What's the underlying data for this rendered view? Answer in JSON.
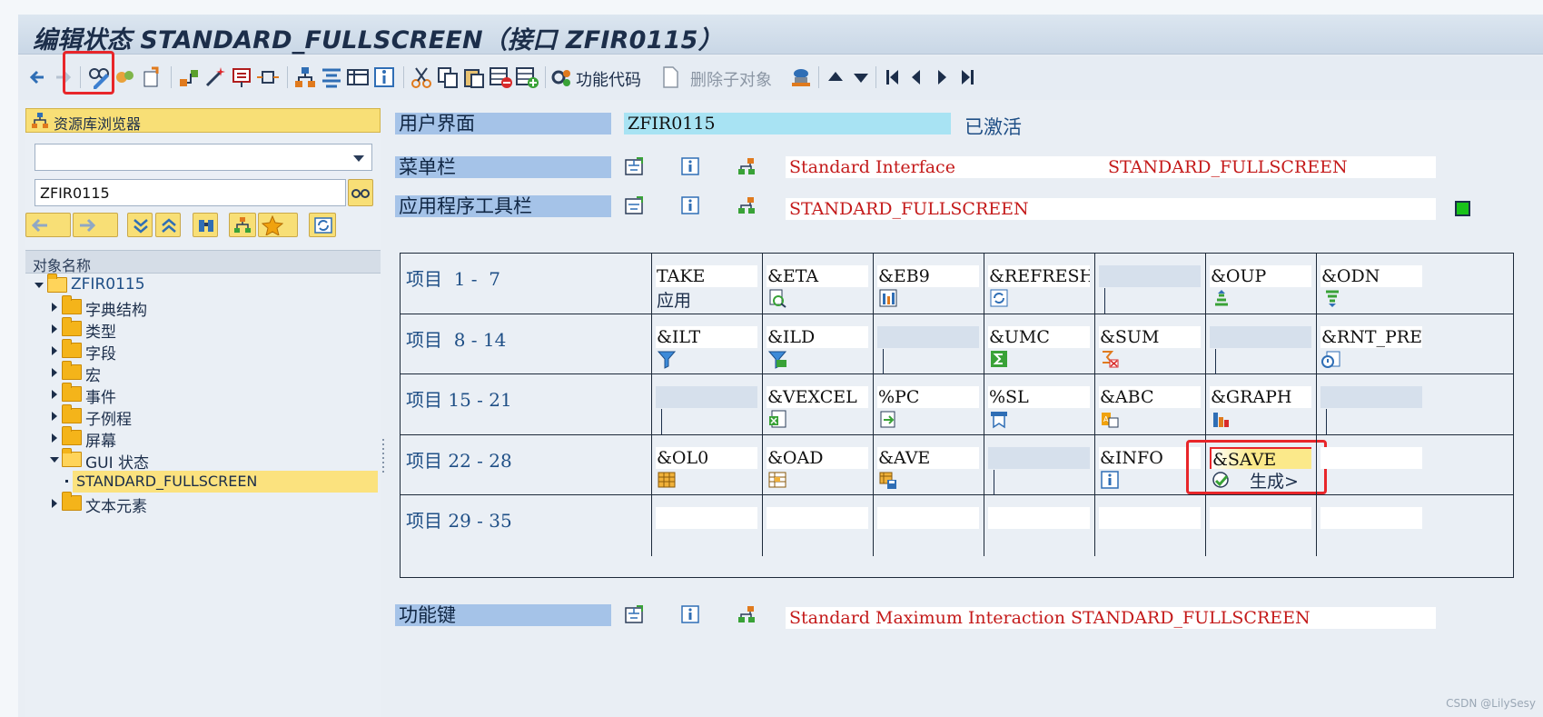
{
  "window": {
    "title": "编辑状态 STANDARD_FULLSCREEN（接口 ZFIR0115）"
  },
  "toolbar": {
    "function_code_label": "功能代码",
    "delete_subobject_label": "删除子对象"
  },
  "left_panel": {
    "repository_browser_label": "资源库浏览器",
    "object_type_value": "",
    "object_name_value": "ZFIR0115",
    "tree_header": "对象名称",
    "tree": {
      "root": "ZFIR0115",
      "items": [
        "字典结构",
        "类型",
        "字段",
        "宏",
        "事件",
        "子例程",
        "屏幕"
      ],
      "gui_status_prefix": "GUI",
      "gui_status_suffix": "状态",
      "selected_status": "STANDARD_FULLSCREEN",
      "text_elements": "文本元素"
    }
  },
  "right_panel": {
    "user_interface": {
      "label": "用户界面",
      "value": "ZFIR0115",
      "status": "已激活"
    },
    "menu_bar": {
      "label": "菜单栏",
      "value_left": "Standard Interface",
      "value_right": "STANDARD_FULLSCREEN"
    },
    "app_toolbar": {
      "label": "应用程序工具栏",
      "value": "STANDARD_FULLSCREEN",
      "status_color": "#19c21a"
    },
    "function_keys": {
      "label": "功能键",
      "value": "Standard Maximum Interaction STANDARD_FULLSCREEN"
    }
  },
  "grid": {
    "rows": [
      {
        "title": "项目  1 -  7",
        "cells": [
          {
            "code": "TAKE",
            "sub": "应用",
            "icon": "none"
          },
          {
            "code": "&ETA",
            "icon": "detail-icon"
          },
          {
            "code": "&EB9",
            "icon": "chart-icon"
          },
          {
            "code": "&REFRESH",
            "icon": "refresh-icon"
          },
          {
            "code": "",
            "icon": "none",
            "bar": true
          },
          {
            "code": "&OUP",
            "icon": "sort-up-icon"
          },
          {
            "code": "&ODN",
            "icon": "sort-down-icon"
          }
        ]
      },
      {
        "title": "项目  8 - 14",
        "cells": [
          {
            "code": "&ILT",
            "icon": "filter-icon"
          },
          {
            "code": "&ILD",
            "icon": "filter-delete-icon"
          },
          {
            "code": "",
            "icon": "none",
            "bar": true
          },
          {
            "code": "&UMC",
            "icon": "sum-icon"
          },
          {
            "code": "&SUM",
            "icon": "subtotal-icon"
          },
          {
            "code": "",
            "icon": "none",
            "bar": true
          },
          {
            "code": "&RNT_PREV",
            "icon": "print-preview-icon"
          }
        ]
      },
      {
        "title": "项目 15 - 21",
        "cells": [
          {
            "code": "",
            "icon": "none",
            "bar": true
          },
          {
            "code": "&VEXCEL",
            "icon": "excel-icon"
          },
          {
            "code": "%PC",
            "icon": "export-icon"
          },
          {
            "code": "%SL",
            "icon": "mail-icon"
          },
          {
            "code": "&ABC",
            "icon": "abc-analysis-icon"
          },
          {
            "code": "&GRAPH",
            "icon": "graph-icon"
          },
          {
            "code": "",
            "icon": "none",
            "bar": true
          }
        ]
      },
      {
        "title": "项目 22 - 28",
        "cells": [
          {
            "code": "&OL0",
            "icon": "layout-icon"
          },
          {
            "code": "&OAD",
            "icon": "layout-select-icon"
          },
          {
            "code": "&AVE",
            "icon": "layout-save-icon"
          },
          {
            "code": "",
            "icon": "none",
            "bar": true
          },
          {
            "code": "&INFO",
            "icon": "info-icon"
          },
          {
            "code": "&SAVE",
            "sub": "生成>",
            "icon": "generate-icon",
            "highlight": true
          },
          {
            "code": "",
            "icon": "none"
          }
        ]
      },
      {
        "title": "项目 29 - 35",
        "cells": [
          {
            "code": "",
            "icon": "none"
          },
          {
            "code": "",
            "icon": "none"
          },
          {
            "code": "",
            "icon": "none"
          },
          {
            "code": "",
            "icon": "none"
          },
          {
            "code": "",
            "icon": "none"
          },
          {
            "code": "",
            "icon": "none"
          },
          {
            "code": "",
            "icon": "none"
          }
        ]
      }
    ]
  },
  "watermark": "CSDN @LilySesy"
}
